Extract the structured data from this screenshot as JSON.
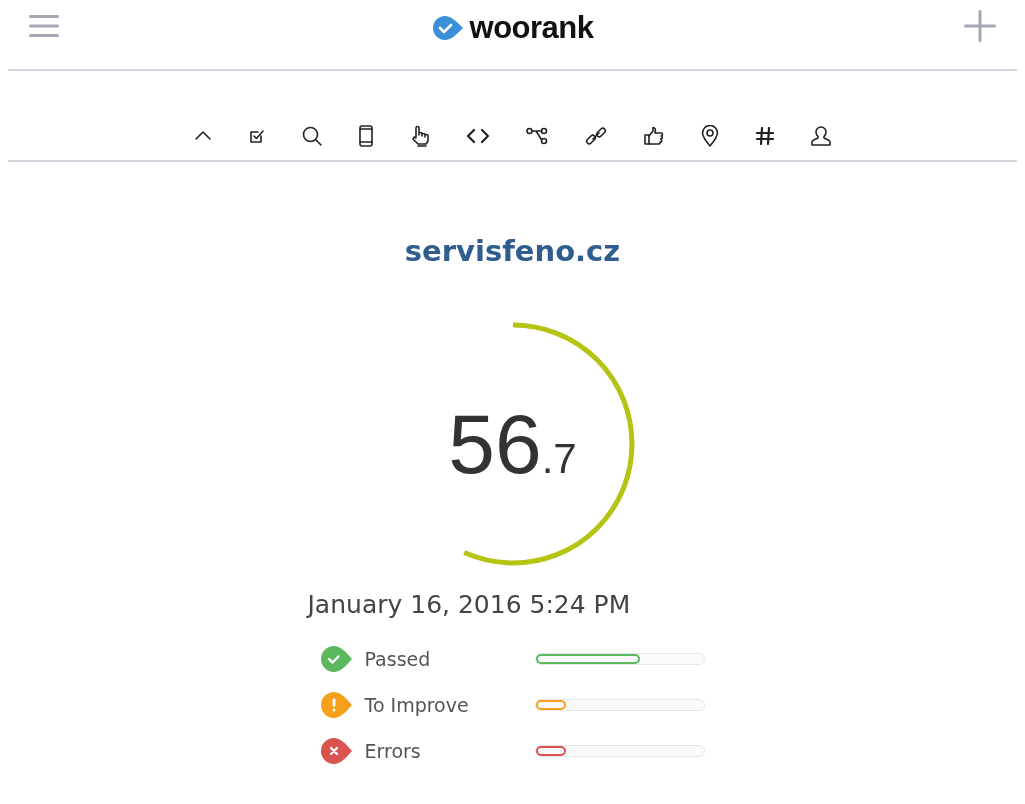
{
  "header": {
    "logo_text": "woorank"
  },
  "domain": "servisfeno.cz",
  "score": {
    "whole": "56",
    "decimal": ".7",
    "level": 0.567
  },
  "date": "January 16, 2016 5:24 PM",
  "statuses": [
    {
      "kind": "passed",
      "label": "Passed",
      "color": "#5cb85c",
      "level": 0.62
    },
    {
      "kind": "improve",
      "label": "To Improve",
      "color": "#f5a01a",
      "level": 0.18
    },
    {
      "kind": "error",
      "label": "Errors",
      "color": "#d9534f",
      "level": 0.18
    }
  ]
}
